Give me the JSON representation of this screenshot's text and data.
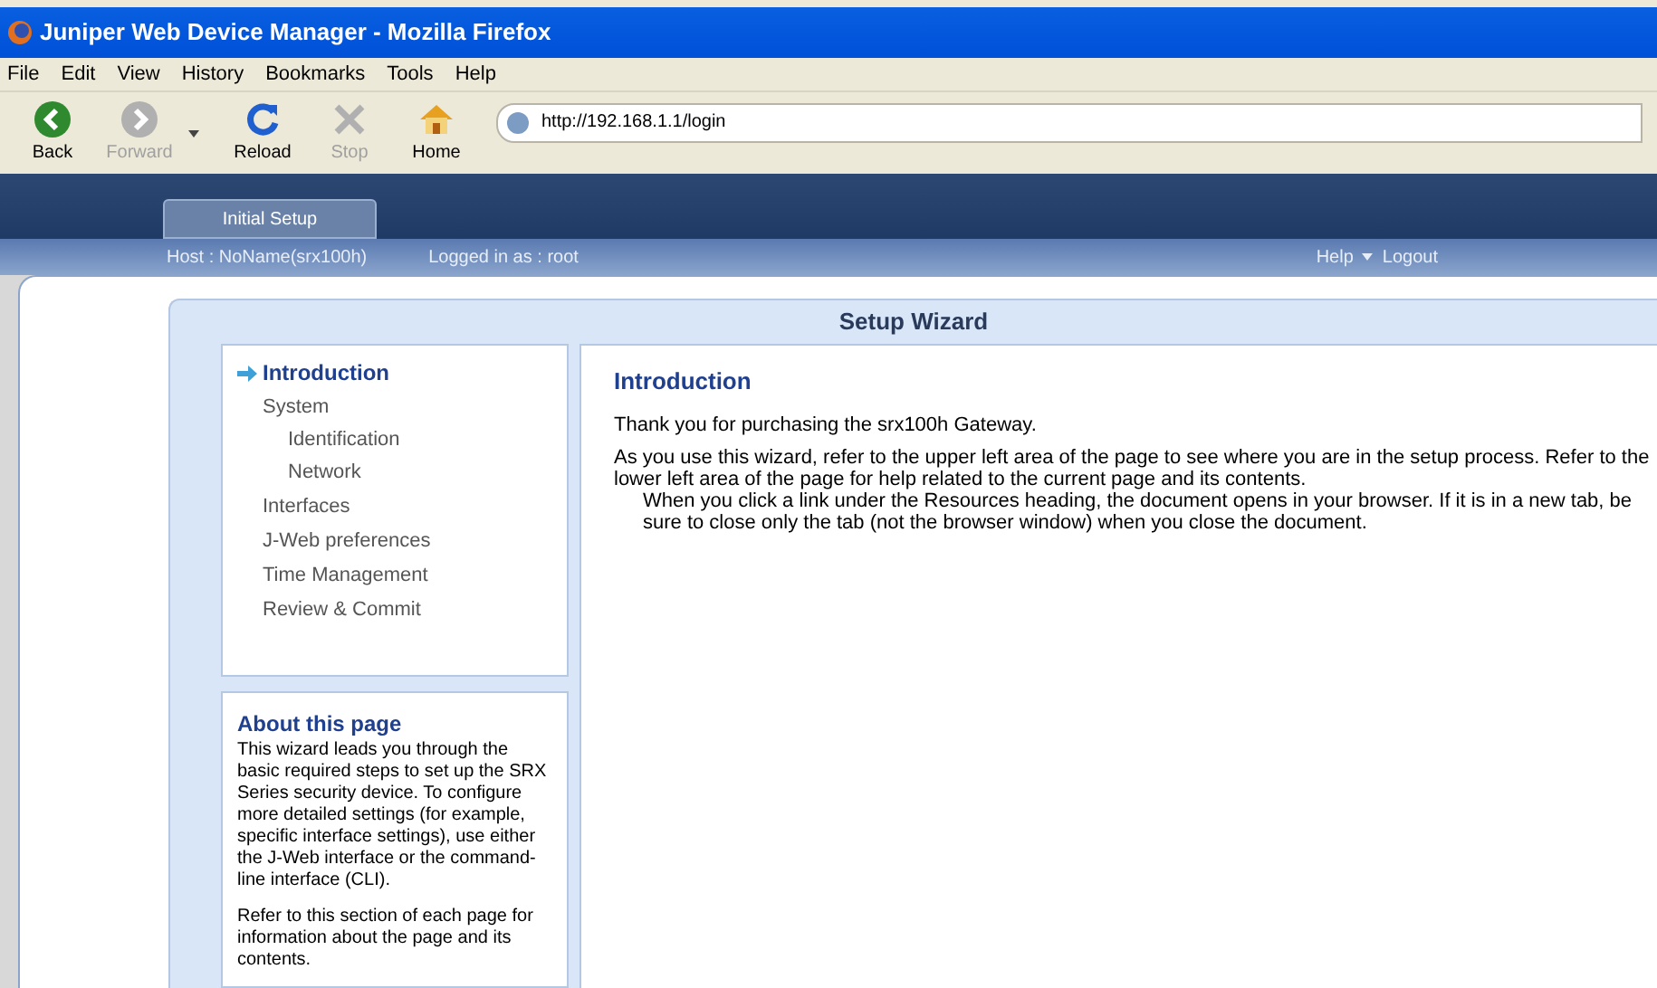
{
  "window": {
    "title": "Juniper Web Device Manager - Mozilla Firefox"
  },
  "menu": [
    "File",
    "Edit",
    "View",
    "History",
    "Bookmarks",
    "Tools",
    "Help"
  ],
  "toolbar": [
    {
      "kind": "back",
      "label": "Back",
      "disabled": false
    },
    {
      "kind": "forward",
      "label": "Forward",
      "disabled": true
    },
    {
      "kind": "reload",
      "label": "Reload",
      "disabled": false
    },
    {
      "kind": "stop",
      "label": "Stop",
      "disabled": true
    },
    {
      "kind": "home",
      "label": "Home",
      "disabled": false
    }
  ],
  "address": "http://192.168.1.1/login",
  "tabs": [
    {
      "label": "Initial Setup",
      "selected": true
    }
  ],
  "status": {
    "host": "Host : NoName(srx100h)",
    "user": "Logged in as : root",
    "help": "Help",
    "logout": "Logout"
  },
  "wizard": {
    "title": "Setup Wizard",
    "steps": [
      {
        "label": "Introduction",
        "selected": true
      },
      {
        "label": "System",
        "selected": false,
        "children": [
          {
            "label": "Identification",
            "selected": false
          },
          {
            "label": "Network",
            "selected": false
          }
        ]
      },
      {
        "label": "Interfaces",
        "selected": false
      },
      {
        "label": "J-Web preferences",
        "selected": false
      },
      {
        "label": "Time Management",
        "selected": false
      },
      {
        "label": "Review & Commit",
        "selected": false
      }
    ],
    "about": {
      "title": "About this page",
      "paragraphs": [
        "This wizard leads you through the basic required steps to set up the SRX Series security device. To configure more detailed settings (for example, specific interface settings), use either the J-Web interface or the command-line interface (CLI).",
        "Refer to this section of each page for information about the page and its contents."
      ]
    },
    "content": {
      "title": "Introduction",
      "paragraphs": [
        {
          "text": "Thank you for purchasing the srx100h Gateway.",
          "indented": false
        },
        {
          "text": "As you use this wizard, refer to the upper left area of the page to see where you are in the setup process. Refer to the lower left area of the page for help related to the current page and its contents.",
          "indented": false
        },
        {
          "text": "When you click a link under the Resources heading, the document opens in your browser. If it is in a new tab, be sure to close only the tab (not the browser window) when you close the document.",
          "indented": true
        }
      ]
    }
  }
}
